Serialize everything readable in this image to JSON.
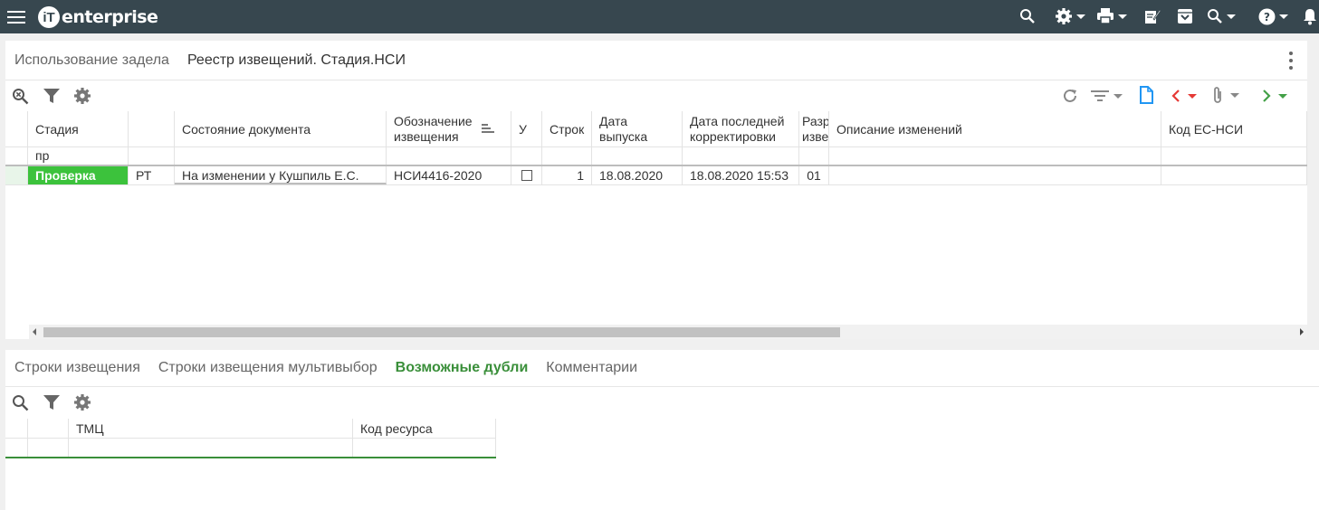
{
  "app": {
    "logo_text": "enterprise",
    "logo_mark": "iT"
  },
  "topbar_icons": [
    "search-icon",
    "gear-icon",
    "print-icon",
    "edit-note-icon",
    "archive-icon",
    "zoom-icon",
    "help-icon",
    "bell-icon"
  ],
  "top_panel": {
    "tabs": [
      {
        "label": "Использование задела"
      },
      {
        "label": "Реестр извещений. Стадия.НСИ"
      }
    ],
    "grid": {
      "columns": {
        "stage": "Стадия",
        "type": "",
        "doc_state": "Состояние документа",
        "designation_1": "Обозначение",
        "designation_2": "извещения",
        "u": "У",
        "rows": "Строк",
        "issue_1": "Дата",
        "issue_2": "выпуска",
        "lastfix_1": "Дата последней",
        "lastfix_2": "корректировки",
        "razr_1": "Разр",
        "razr_2": "изве",
        "description": "Описание изменений",
        "code": "Код ЕС-НСИ"
      },
      "filter": {
        "stage": "пр"
      },
      "rows": [
        {
          "stage": "Проверка",
          "type": "РТ",
          "doc_state": "На изменении у  Кушпиль Е.С.",
          "designation": "НСИ4416-2020",
          "u_checked": false,
          "rows": "1",
          "issue_date": "18.08.2020",
          "last_fix": "18.08.2020 15:53",
          "razr": "01",
          "description": "",
          "code": ""
        }
      ]
    },
    "colors": {
      "status_green": "#3cc23c",
      "accent_blue": "#2196f3",
      "prev_red": "#e53935",
      "next_green": "#43a047"
    }
  },
  "bottom_panel": {
    "tabs": [
      {
        "label": "Строки извещения"
      },
      {
        "label": "Строки извещения мультивыбор"
      },
      {
        "label": "Возможные дубли"
      },
      {
        "label": "Комментарии"
      }
    ],
    "grid": {
      "columns": {
        "tmc": "ТМЦ",
        "resource_code": "Код ресурса"
      }
    }
  }
}
